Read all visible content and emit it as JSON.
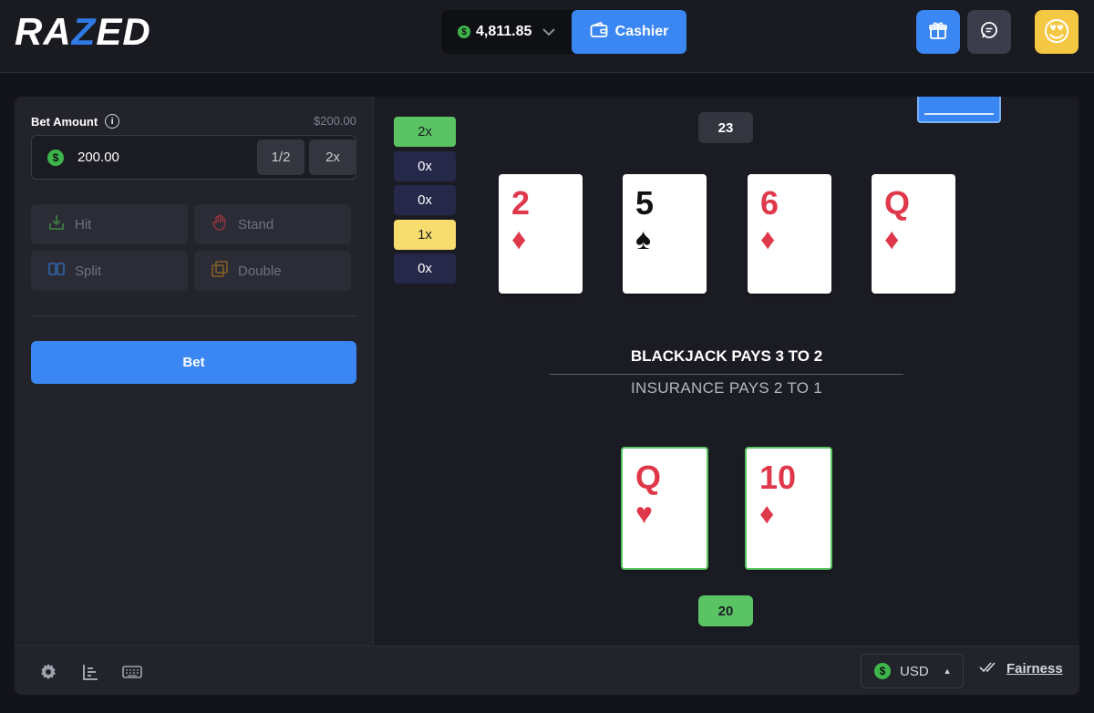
{
  "header": {
    "logo_prefix": "RA",
    "logo_accent": "Z",
    "logo_suffix": "ED",
    "balance": "4,811.85",
    "coin_symbol": "$",
    "cashier_label": "Cashier",
    "avatar_emoji": "😍"
  },
  "sidebar": {
    "bet_amount_label": "Bet Amount",
    "max_value": "$200.00",
    "bet_amount_value": "200.00",
    "half_label": "1/2",
    "double_label": "2x",
    "hit_label": "Hit",
    "stand_label": "Stand",
    "split_label": "Split",
    "double_down_label": "Double",
    "bet_button_label": "Bet"
  },
  "multipliers": [
    "2x",
    "0x",
    "0x",
    "1x",
    "0x"
  ],
  "dealer": {
    "score": "23",
    "cards": [
      {
        "rank": "2",
        "suit": "♦",
        "color": "red"
      },
      {
        "rank": "5",
        "suit": "♠",
        "color": "black"
      },
      {
        "rank": "6",
        "suit": "♦",
        "color": "red"
      },
      {
        "rank": "Q",
        "suit": "♦",
        "color": "red"
      }
    ]
  },
  "player": {
    "score": "20",
    "cards": [
      {
        "rank": "Q",
        "suit": "♥",
        "color": "red"
      },
      {
        "rank": "10",
        "suit": "♦",
        "color": "red"
      }
    ]
  },
  "table_text": {
    "blackjack_pays": "BLACKJACK PAYS 3 TO 2",
    "insurance_pays": "INSURANCE PAYS 2 TO 1"
  },
  "footer": {
    "currency": "USD",
    "fairness_label": "Fairness"
  },
  "colors": {
    "accent_blue": "#3a86f2",
    "win_green": "#5ac464",
    "push_yellow": "#f7dc6e",
    "card_red": "#e0384b"
  }
}
